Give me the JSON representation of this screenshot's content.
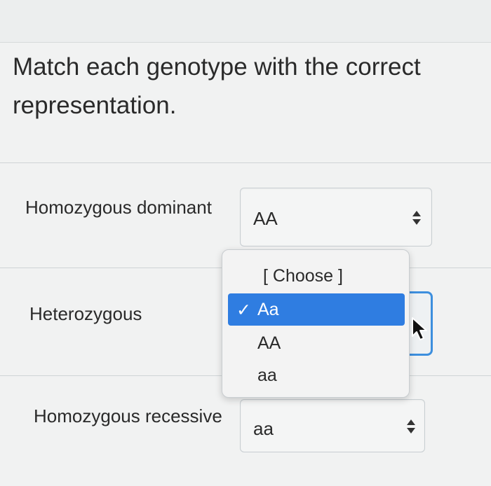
{
  "question": {
    "text": "Match each genotype with the correct representation."
  },
  "rows": [
    {
      "label": "Homozygous dominant",
      "selected": "AA"
    },
    {
      "label": "Heterozygous",
      "selected": "Aa"
    },
    {
      "label": "Homozygous recessive",
      "selected": "aa"
    }
  ],
  "dropdown": {
    "options": [
      "[ Choose ]",
      "Aa",
      "AA",
      "aa"
    ],
    "selected_index": 1,
    "checkmark": "✓"
  },
  "colors": {
    "highlight": "#2f7de1",
    "focus_border": "#3d8fde",
    "text": "#2a2a2a"
  },
  "icons": [
    "select-arrows-icon",
    "checkmark-icon",
    "mouse-cursor-icon"
  ]
}
